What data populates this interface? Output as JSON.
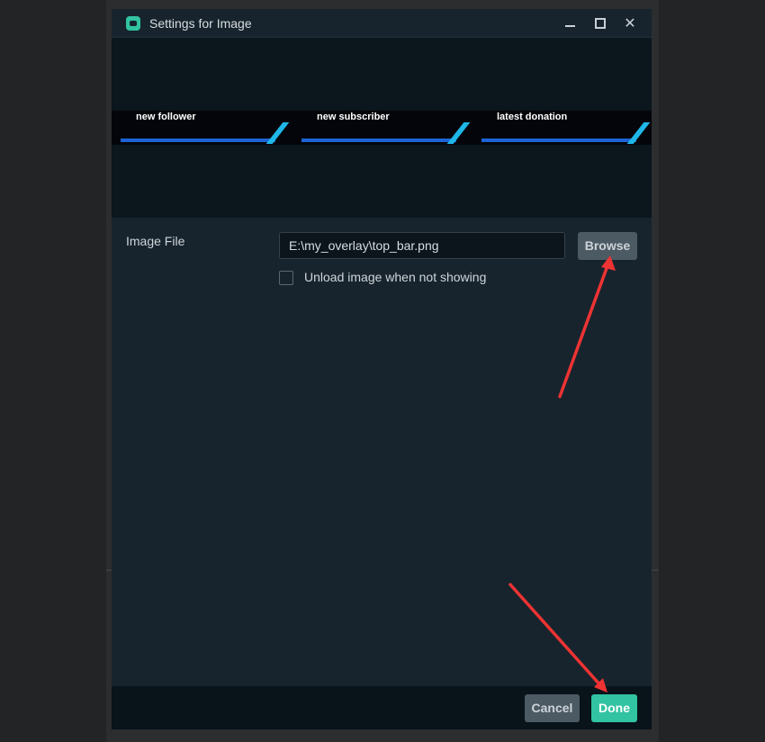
{
  "window": {
    "title": "Settings for Image"
  },
  "preview": {
    "segments": [
      {
        "label": "new follower"
      },
      {
        "label": "new subscriber"
      },
      {
        "label": "latest donation"
      }
    ]
  },
  "form": {
    "image_file_label": "Image File",
    "image_file_value": "E:\\my_overlay\\top_bar.png",
    "browse_label": "Browse",
    "unload_label": "Unload image when not showing",
    "unload_checked": false
  },
  "footer": {
    "cancel_label": "Cancel",
    "done_label": "Done"
  },
  "colors": {
    "accent": "#31c3a2",
    "window_bg": "#17242d",
    "annotation": "#ee3333"
  },
  "icons": [
    "app-icon",
    "minimize-icon",
    "maximize-icon",
    "close-icon"
  ]
}
